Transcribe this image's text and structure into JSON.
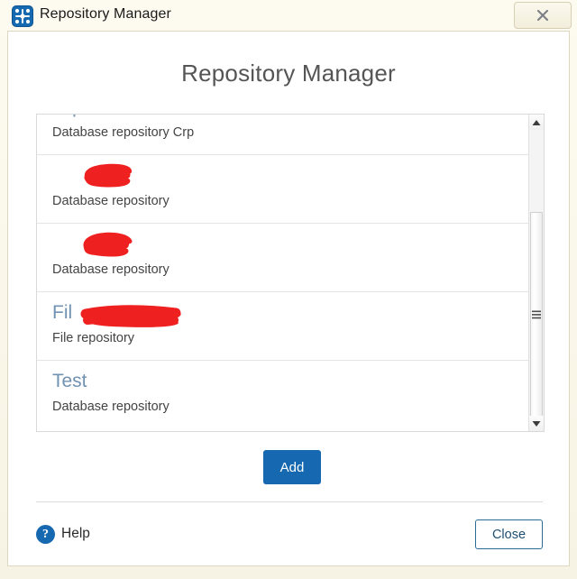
{
  "window": {
    "title": "Repository Manager",
    "app_icon": "network-nodes-icon",
    "close_icon": "close-x-icon",
    "frame_color": "#f7f3e4"
  },
  "page": {
    "heading": "Repository Manager"
  },
  "repository_list": {
    "items": [
      {
        "name": "Crp",
        "description": "Database repository Crp",
        "redacted": false
      },
      {
        "name": "",
        "description": "Database repository",
        "redacted": true,
        "redaction_style": "short"
      },
      {
        "name": "",
        "description": "Database repository",
        "redacted": true,
        "redaction_style": "short"
      },
      {
        "name": "Fil",
        "description": "File repository",
        "redacted": true,
        "redaction_style": "wide"
      },
      {
        "name": "Test",
        "description": "Database repository",
        "redacted": false
      }
    ],
    "scrollbar": {
      "up_icon": "triangle-up-icon",
      "down_icon": "triangle-down-icon",
      "grip_icon": "grip-lines-icon"
    }
  },
  "actions": {
    "add_label": "Add",
    "add_color": "#1668b0"
  },
  "footer": {
    "help_label": "Help",
    "help_icon": "question-mark-circle-icon",
    "close_label": "Close",
    "close_border_color": "#2a6b94"
  }
}
